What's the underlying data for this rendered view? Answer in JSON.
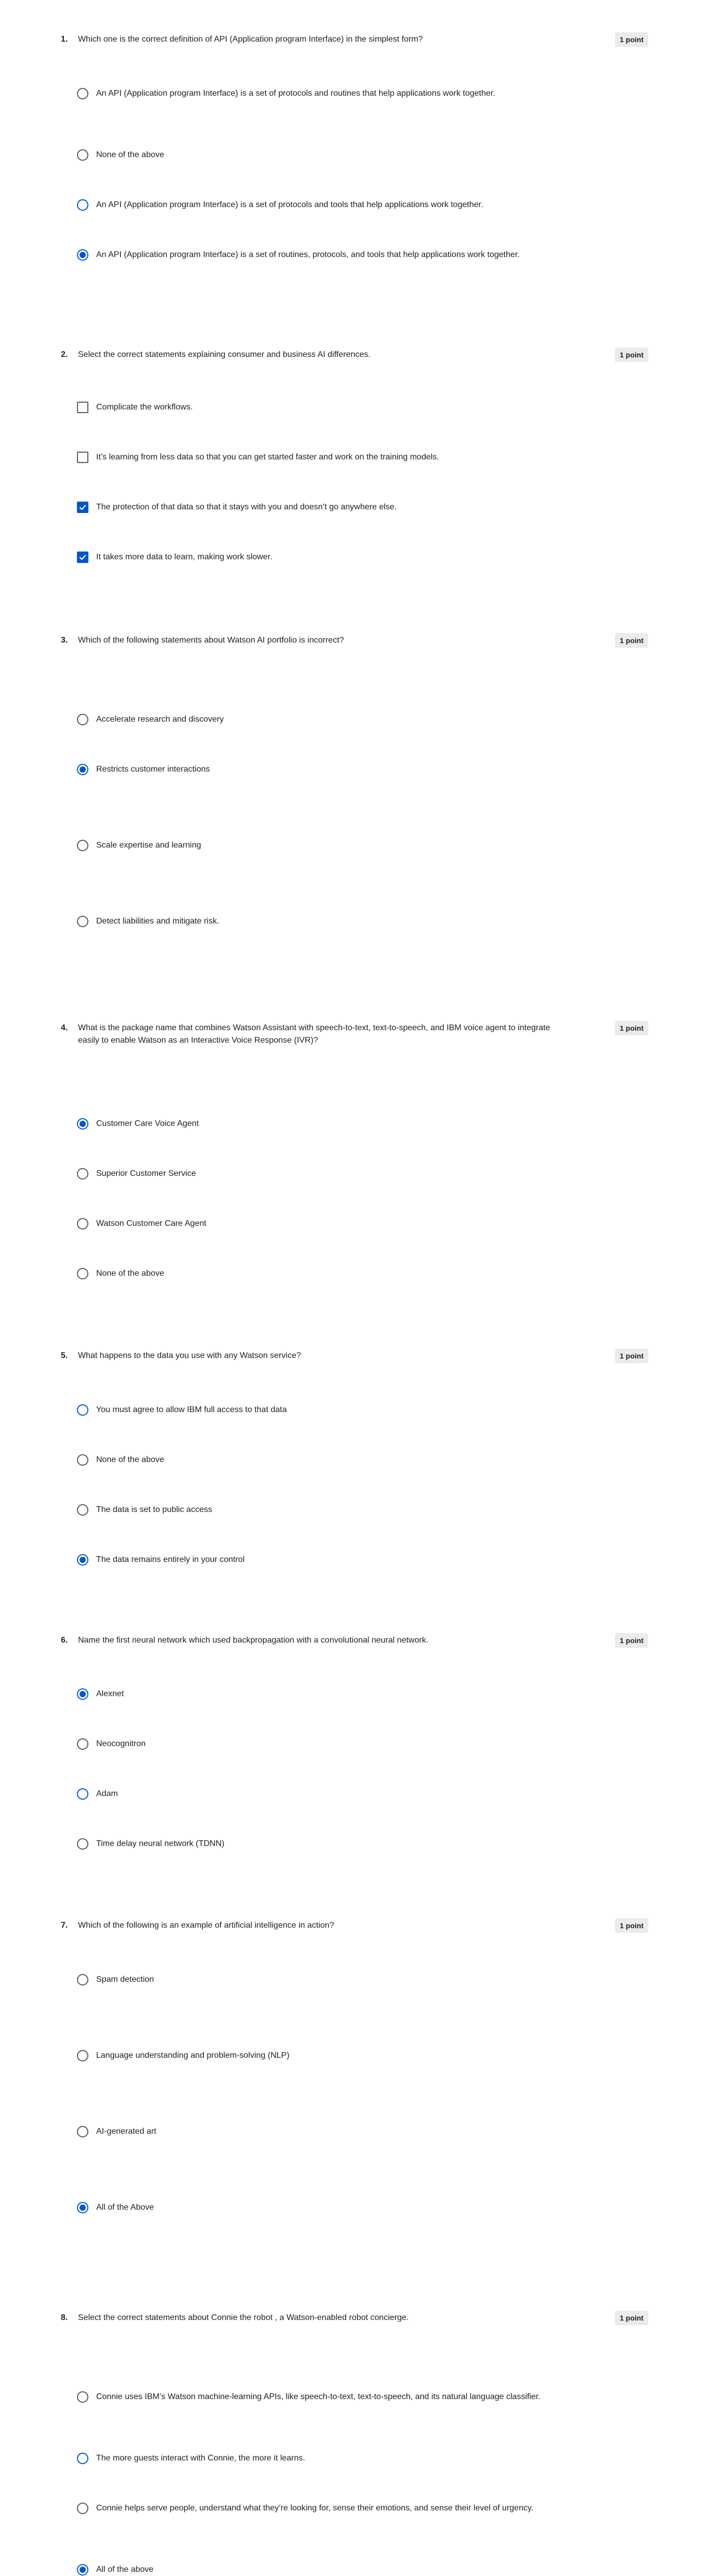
{
  "questions": [
    {
      "number": "1.",
      "text": "Which one is the correct definition of API (Application program Interface) in the simplest form?",
      "points": "1 point",
      "type": "radio",
      "options": [
        {
          "text": "An API (Application program Interface) is a set of protocols and routines that help applications work together.",
          "selected": false
        },
        {
          "text": "None of the above",
          "selected": false
        },
        {
          "text": "An API (Application program Interface) is a set of protocols and tools that help applications work together.",
          "selected": false
        },
        {
          "text": "An API (Application program Interface) is a set of routines, protocols, and tools that help applications work together.",
          "selected": true
        }
      ]
    },
    {
      "number": "2.",
      "text": "Select the correct statements explaining consumer and business AI differences.",
      "points": "1 point",
      "type": "checkbox",
      "options": [
        {
          "text": "Complicate the workflows.",
          "selected": false
        },
        {
          "text": " It’s learning from less data so that you can get started faster and work on the training models.",
          "selected": false
        },
        {
          "text": "The protection of that data so that it stays with you and doesn’t go anywhere else.",
          "selected": true
        },
        {
          "text": "It takes more data to learn, making work slower.",
          "selected": true
        }
      ]
    },
    {
      "number": "3.",
      "text": "Which of the following statements about Watson AI portfolio is incorrect?",
      "points": "1 point",
      "type": "radio",
      "options": [
        {
          "text": "Accelerate research and discovery",
          "selected": false
        },
        {
          "text": "Restricts customer interactions",
          "selected": true
        },
        {
          "text": "Scale expertise and learning",
          "selected": false
        },
        {
          "text": "Detect liabilities and mitigate risk.",
          "selected": false
        }
      ]
    },
    {
      "number": "4.",
      "text": "What is the package name that combines Watson Assistant with speech-to-text, text-to-speech, and IBM voice agent to integrate easily to enable Watson as an Interactive Voice Response (IVR)?",
      "points": "1 point",
      "type": "radio",
      "options": [
        {
          "text": "Customer Care Voice Agent",
          "selected": true
        },
        {
          "text": "Superior Customer Service",
          "selected": false
        },
        {
          "text": "Watson Customer Care Agent",
          "selected": false
        },
        {
          "text": "None of the above",
          "selected": false
        }
      ]
    },
    {
      "number": "5.",
      "text": "What happens to the data you use with any Watson service?",
      "points": "1 point",
      "type": "radio",
      "options": [
        {
          "text": "You must agree to allow IBM full access to that data",
          "selected": false
        },
        {
          "text": "None of the above",
          "selected": false
        },
        {
          "text": "The data is set to public access",
          "selected": false
        },
        {
          "text": "The data remains entirely in your control",
          "selected": true
        }
      ]
    },
    {
      "number": "6.",
      "text": "Name the first neural network which used backpropagation with a convolutional neural network.",
      "points": "1 point",
      "type": "radio",
      "options": [
        {
          "text": "Alexnet",
          "selected": true
        },
        {
          "text": "Neocognitron",
          "selected": false
        },
        {
          "text": "Adam",
          "selected": false
        },
        {
          "text": "Time delay neural network (TDNN)",
          "selected": false
        }
      ]
    },
    {
      "number": "7.",
      "text": "Which of the following is an example of artificial intelligence in action?",
      "points": "1 point",
      "type": "radio",
      "options": [
        {
          "text": "Spam detection",
          "selected": false
        },
        {
          "text": "Language understanding and problem-solving (NLP)",
          "selected": false
        },
        {
          "text": "AI-generated art",
          "selected": false
        },
        {
          "text": "All of the Above",
          "selected": true
        }
      ]
    },
    {
      "number": "8.",
      "text": "Select the correct statements about Connie the  robot , a Watson-enabled robot concierge.",
      "points": "1 point",
      "type": "radio",
      "options": [
        {
          "text": "Connie uses IBM’s Watson machine-learning APIs, like speech-to-text, text-to-speech, and its natural language classifier.",
          "selected": false
        },
        {
          "text": "The more guests interact with Connie, the more it learns.",
          "selected": false
        },
        {
          "text": "Connie helps serve people, understand what they’re looking for, sense their emotions, and sense their level of urgency.",
          "selected": false
        },
        {
          "text": "All of the above",
          "selected": true
        }
      ]
    }
  ],
  "colors": {
    "accent": "#0056d2",
    "text": "#1f1f1f",
    "control_border": "#5a5a5a",
    "points_badge": "#ebebeb"
  }
}
